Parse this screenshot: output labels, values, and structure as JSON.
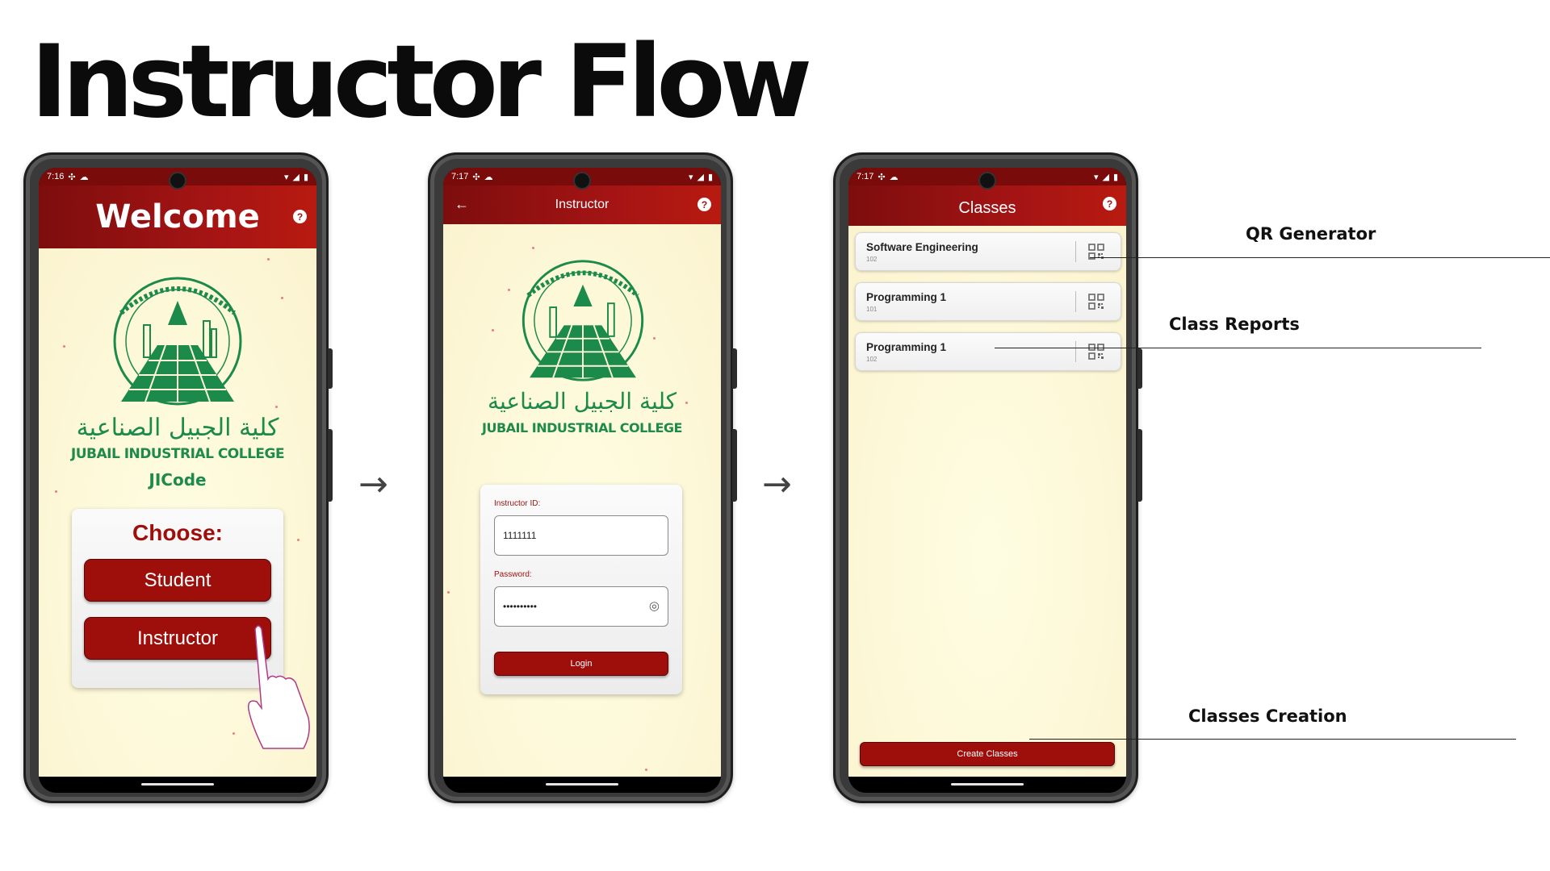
{
  "page": {
    "title": "Instructor Flow"
  },
  "status": {
    "time_1": "7:16",
    "time_2": "7:17",
    "time_3": "7:17"
  },
  "welcome_screen": {
    "title": "Welcome",
    "college_arabic": "كلية الجبيل الصناعية",
    "college_english": "JUBAIL INDUSTRIAL COLLEGE",
    "app_name": "JICode",
    "choose_label": "Choose:",
    "student_button": "Student",
    "instructor_button": "Instructor"
  },
  "login_screen": {
    "title": "Instructor",
    "college_arabic": "كلية الجبيل الصناعية",
    "college_english": "JUBAIL INDUSTRIAL COLLEGE",
    "id_label": "Instructor ID:",
    "id_value": "1111111",
    "password_label": "Password:",
    "password_value": "••••••••••",
    "login_button": "Login"
  },
  "classes_screen": {
    "title": "Classes",
    "classes": [
      {
        "name": "Software Engineering",
        "code": "102"
      },
      {
        "name": "Programming 1",
        "code": "101"
      },
      {
        "name": "Programming 1",
        "code": "102"
      }
    ],
    "create_button": "Create Classes"
  },
  "annotations": {
    "qr_generator": "QR Generator",
    "class_reports": "Class Reports",
    "classes_creation": "Classes Creation"
  },
  "colors": {
    "primary": "#9e0f0b",
    "appbar_dark": "#7d0d0d",
    "logo_green": "#1b8a4a",
    "background_cream": "#fdf8d8"
  }
}
